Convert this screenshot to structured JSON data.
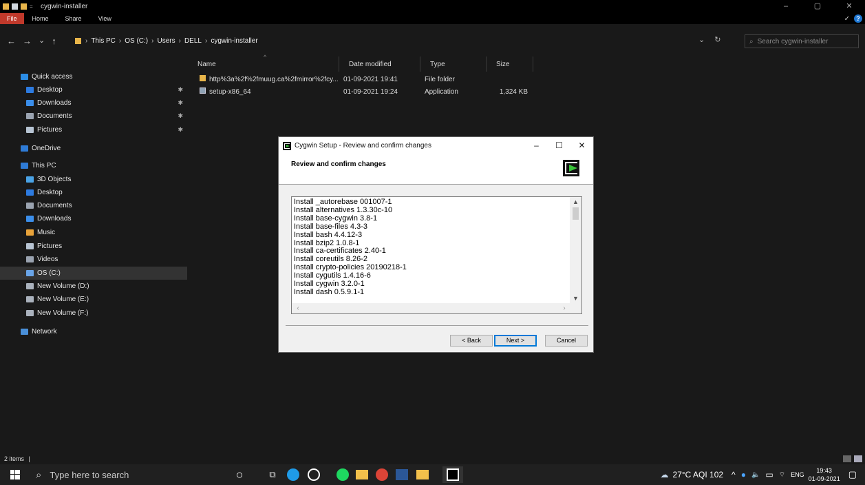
{
  "window": {
    "title": "cygwin-installer",
    "controls": [
      "–",
      "▢",
      "✕"
    ]
  },
  "ribbon": {
    "tabs": [
      "File",
      "Home",
      "Share",
      "View"
    ]
  },
  "nav": {
    "back": "←",
    "forward": "→",
    "recent": "⌄",
    "up": "↑",
    "breadcrumb": [
      "This PC",
      "OS (C:)",
      "Users",
      "DELL",
      "cygwin-installer"
    ],
    "search_placeholder": "Search cygwin-installer"
  },
  "sidebar": {
    "items": [
      {
        "label": "Quick access",
        "icon": "star-icon",
        "color": "#2b8de6",
        "pinned": false
      },
      {
        "label": "Desktop",
        "icon": "desktop-icon",
        "color": "#2d7be0",
        "pinned": true
      },
      {
        "label": "Downloads",
        "icon": "download-icon",
        "color": "#3b8eea",
        "pinned": true
      },
      {
        "label": "Documents",
        "icon": "document-icon",
        "color": "#9aa3b0",
        "pinned": true
      },
      {
        "label": "Pictures",
        "icon": "pictures-icon",
        "color": "#b7c4d3",
        "pinned": true
      },
      {
        "label": "OneDrive",
        "icon": "cloud-icon",
        "color": "#2e7bd6",
        "pinned": false
      },
      {
        "label": "This PC",
        "icon": "computer-icon",
        "color": "#2e7bd6",
        "pinned": false
      },
      {
        "label": "3D Objects",
        "icon": "cube-icon",
        "color": "#4aa3e6",
        "pinned": false
      },
      {
        "label": "Desktop",
        "icon": "desktop-icon",
        "color": "#2d7be0",
        "pinned": false
      },
      {
        "label": "Documents",
        "icon": "document-icon",
        "color": "#9aa3b0",
        "pinned": false
      },
      {
        "label": "Downloads",
        "icon": "download-icon",
        "color": "#3b8eea",
        "pinned": false
      },
      {
        "label": "Music",
        "icon": "music-icon",
        "color": "#e8a33a",
        "pinned": false
      },
      {
        "label": "Pictures",
        "icon": "pictures-icon",
        "color": "#b7c4d3",
        "pinned": false
      },
      {
        "label": "Videos",
        "icon": "video-icon",
        "color": "#9aa3b0",
        "pinned": false
      },
      {
        "label": "OS (C:)",
        "icon": "drive-icon",
        "color": "#6aa5e8",
        "pinned": false
      },
      {
        "label": "New Volume (D:)",
        "icon": "drive-icon",
        "color": "#aab2bd",
        "pinned": false
      },
      {
        "label": "New Volume (E:)",
        "icon": "drive-icon",
        "color": "#aab2bd",
        "pinned": false
      },
      {
        "label": "New Volume (F:)",
        "icon": "drive-icon",
        "color": "#aab2bd",
        "pinned": false
      },
      {
        "label": "Network",
        "icon": "network-icon",
        "color": "#4a90d9",
        "pinned": false
      }
    ]
  },
  "files": {
    "columns": [
      "Name",
      "Date modified",
      "Type",
      "Size"
    ],
    "rows": [
      {
        "name": "http%3a%2f%2fmuug.ca%2fmirror%2fcy...",
        "date": "01-09-2021 19:41",
        "type": "File folder",
        "size": "",
        "icon": "folder-icon"
      },
      {
        "name": "setup-x86_64",
        "date": "01-09-2021 19:24",
        "type": "Application",
        "size": "1,324 KB",
        "icon": "application-icon"
      }
    ]
  },
  "status": {
    "count": "2 items"
  },
  "dialog": {
    "title": "Cygwin Setup - Review and confirm changes",
    "heading": "Review and confirm changes",
    "items": [
      "Install _autorebase 001007-1",
      "Install alternatives 1.3.30c-10",
      "Install base-cygwin 3.8-1",
      "Install base-files 4.3-3",
      "Install bash 4.4.12-3",
      "Install bzip2 1.0.8-1",
      "Install ca-certificates 2.40-1",
      "Install coreutils 8.26-2",
      "Install crypto-policies 20190218-1",
      "Install cygutils 1.4.16-6",
      "Install cygwin 3.2.0-1",
      "Install dash 0.5.9.1-1"
    ],
    "back_label": "< Back",
    "next_label": "Next >",
    "cancel_label": "Cancel"
  },
  "taskbar": {
    "search_placeholder": "Type here to search",
    "weather": "27°C  AQI 102",
    "lang": "ENG",
    "time": "19:43",
    "date": "01-09-2021"
  }
}
